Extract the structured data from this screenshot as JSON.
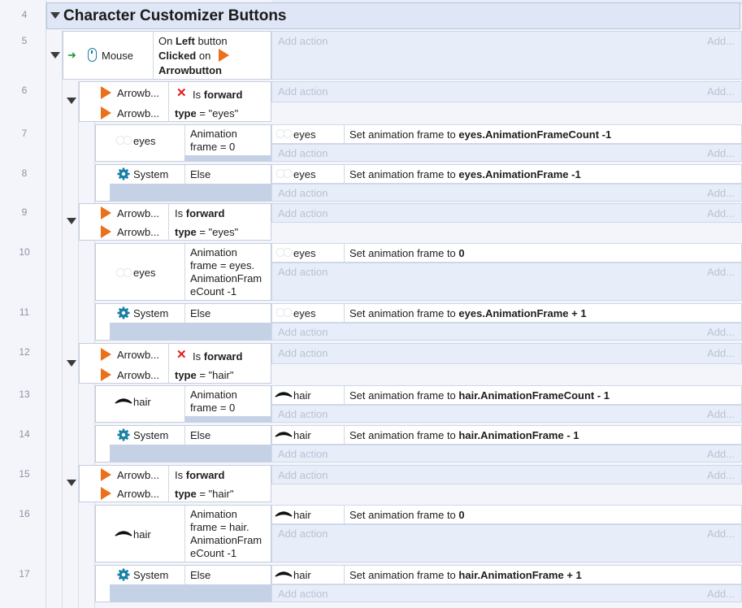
{
  "group": {
    "line": "4",
    "title": "Character Customizer Buttons"
  },
  "add_action": "Add action",
  "add_more": "Add...",
  "event5": {
    "line": "5",
    "object": "Mouse",
    "cond_a": "On",
    "cond_b": "Left",
    "cond_c": "button",
    "cond_d": "Clicked",
    "cond_e": "on",
    "cond_f": "Arrowbutton"
  },
  "events": [
    {
      "line": "6",
      "obj1": "Arrowb...",
      "obj2": "Arrowb...",
      "c1_pre": "Is",
      "c1_bold": "forward",
      "c2_bold": "type",
      "c2_rest": " = \"eyes\""
    },
    {
      "line": "7",
      "obj": "eyes",
      "cond": "Animation frame = 0",
      "act_obj": "eyes",
      "act_pre": "Set animation frame to ",
      "act_bold": "eyes.AnimationFrameCount -1"
    },
    {
      "line": "8",
      "obj": "System",
      "cond": "Else",
      "act_obj": "eyes",
      "act_pre": "Set animation frame to ",
      "act_bold": "eyes.AnimationFrame -1"
    },
    {
      "line": "9",
      "obj1": "Arrowb...",
      "obj2": "Arrowb...",
      "c1_pre": "Is",
      "c1_bold": "forward",
      "c2_bold": "type",
      "c2_rest": " = \"eyes\""
    },
    {
      "line": "10",
      "obj": "eyes",
      "cond": "Animation frame = eyes. AnimationFram eCount -1",
      "act_obj": "eyes",
      "act_pre": "Set animation frame to ",
      "act_bold": "0"
    },
    {
      "line": "11",
      "obj": "System",
      "cond": "Else",
      "act_obj": "eyes",
      "act_pre": "Set animation frame to ",
      "act_bold": "eyes.AnimationFrame + 1"
    },
    {
      "line": "12",
      "obj1": "Arrowb...",
      "obj2": "Arrowb...",
      "c1_pre": "Is",
      "c1_bold": "forward",
      "c2_bold": "type",
      "c2_rest": " = \"hair\""
    },
    {
      "line": "13",
      "obj": "hair",
      "cond": "Animation frame = 0",
      "act_obj": "hair",
      "act_pre": "Set animation frame to ",
      "act_bold": "hair.AnimationFrameCount - 1"
    },
    {
      "line": "14",
      "obj": "System",
      "cond": "Else",
      "act_obj": "hair",
      "act_pre": "Set animation frame to ",
      "act_bold": "hair.AnimationFrame - 1"
    },
    {
      "line": "15",
      "obj1": "Arrowb...",
      "obj2": "Arrowb...",
      "c1_pre": "Is",
      "c1_bold": "forward",
      "c2_bold": "type",
      "c2_rest": " = \"hair\""
    },
    {
      "line": "16",
      "obj": "hair",
      "cond": "Animation frame = hair. AnimationFram eCount -1",
      "act_obj": "hair",
      "act_pre": "Set animation frame to ",
      "act_bold": "0"
    },
    {
      "line": "17",
      "obj": "System",
      "cond": "Else",
      "act_obj": "hair",
      "act_pre": "Set animation frame to ",
      "act_bold": "hair.AnimationFrame + 1"
    }
  ],
  "colors": {
    "accent_orange": "#ec6f1a",
    "gear_teal": "#1b7fa6",
    "invert_red": "#e11b1b",
    "group_bg": "#dfe6f5"
  }
}
